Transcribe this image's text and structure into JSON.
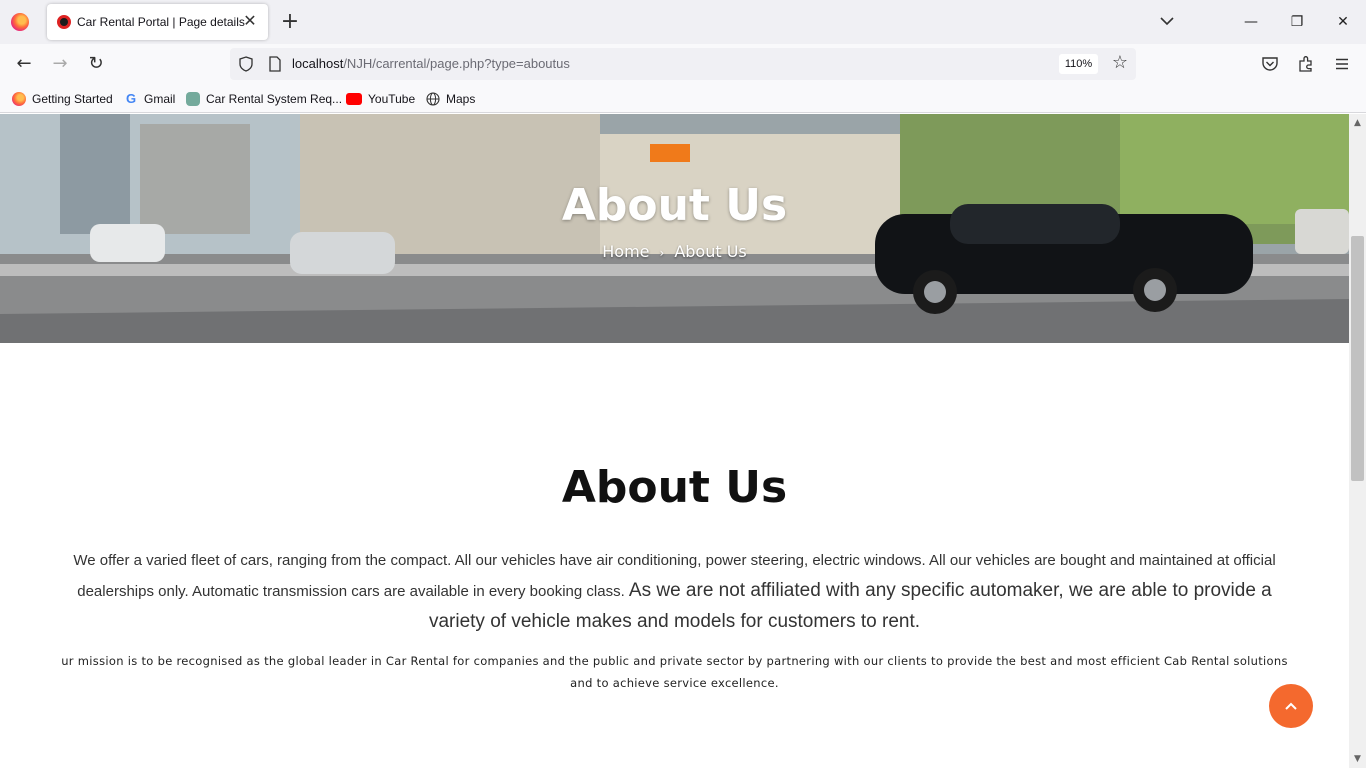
{
  "browser": {
    "tab": {
      "title": "Car Rental Portal | Page details",
      "close_label": "✕"
    },
    "new_tab_label": "+",
    "window_controls": {
      "minimize": "—",
      "restore": "❐",
      "close": "✕"
    },
    "nav": {
      "back": "←",
      "forward": "→",
      "reload": "↻"
    },
    "url": {
      "host": "localhost",
      "path": "/NJH/carrental/page.php?type=aboutus",
      "zoom": "110%"
    },
    "bookmarks": [
      {
        "label": "Getting Started",
        "icon": "firefox-icon"
      },
      {
        "label": "Gmail",
        "icon": "google-icon"
      },
      {
        "label": "Car Rental System Req...",
        "icon": "chatgpt-icon"
      },
      {
        "label": "YouTube",
        "icon": "youtube-icon"
      },
      {
        "label": "Maps",
        "icon": "globe-icon"
      }
    ]
  },
  "hero": {
    "title": "About Us",
    "breadcrumb": {
      "home": "Home",
      "separator": "›",
      "current": "About Us"
    }
  },
  "about": {
    "title": "About Us",
    "paragraph1_small": "We offer a varied fleet of cars, ranging from the compact. All our vehicles have air conditioning,  power steering, electric windows. All our vehicles are bought and maintained at official dealerships only. Automatic transmission cars are available in every booking class. ",
    "paragraph1_large": "As we are not affiliated with any specific automaker, we are able to provide a variety of vehicle makes and models for customers to rent.",
    "paragraph2": "ur mission is to be recognised as the global leader in Car Rental for companies and the public and private sector by partnering with our clients to provide the best and most efficient Cab Rental solutions and to achieve service excellence."
  },
  "back_to_top": "⌃",
  "colors": {
    "accent": "#f4692e",
    "tabbar": "#f0f0f4",
    "toolbar": "#f9f9fb"
  }
}
